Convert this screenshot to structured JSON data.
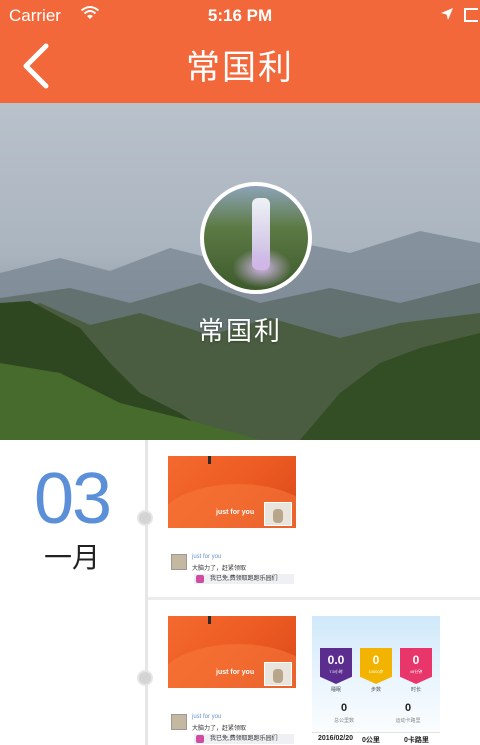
{
  "status_bar": {
    "carrier": "Carrier",
    "time": "5:16 PM"
  },
  "nav": {
    "title": "常国利"
  },
  "profile": {
    "name": "常国利"
  },
  "timeline": {
    "day": "03",
    "month": "一月",
    "entries": [
      {
        "caption": "just for you",
        "user": "just for you",
        "text": "大脑力了，赶紧领取",
        "tag": "我已免,费领取跑跑乐园们"
      },
      {
        "caption": "just for you",
        "user": "just for you",
        "text": "大脑力了，赶紧领取",
        "tag": "我已免,费领取跑跑乐园们"
      }
    ],
    "stats": {
      "badges": [
        {
          "value": "0.0",
          "sub": "7.5小时",
          "color": "#5b2d8f",
          "label": "睡眠"
        },
        {
          "value": "0",
          "sub": "10000步",
          "color": "#f2b400",
          "label": "步数"
        },
        {
          "value": "0",
          "sub": "48分钟",
          "color": "#e8356a",
          "label": "时长"
        }
      ],
      "totals": [
        {
          "value": "0",
          "label": "总公里数"
        },
        {
          "value": "0",
          "label": "运动卡路里"
        }
      ],
      "footer": {
        "date": "2016/02/20",
        "distance": "0公里",
        "calories": "0卡路里"
      }
    }
  },
  "colors": {
    "brand": "#f2683a",
    "date_accent": "#5b90d8"
  },
  "icons": [
    "wifi-icon",
    "back-icon",
    "location-arrow-icon",
    "battery-icon"
  ]
}
